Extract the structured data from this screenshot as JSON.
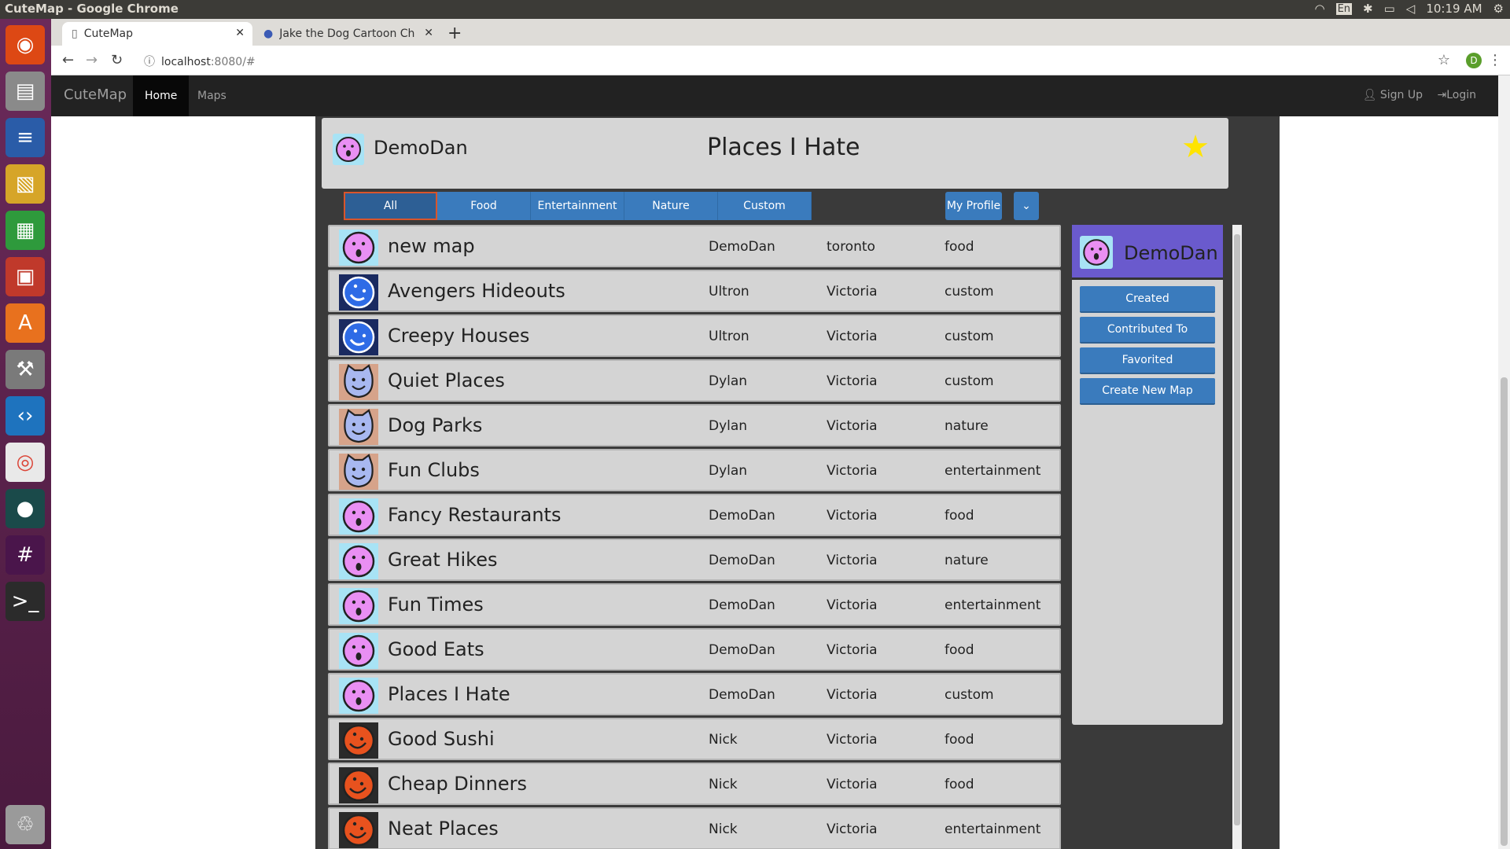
{
  "os": {
    "window_title": "CuteMap - Google Chrome",
    "clock": "10:19 AM",
    "kbd": "En"
  },
  "launcher": {
    "icons": [
      "ubuntu-icon",
      "files-icon",
      "writer-icon",
      "impress-draw-icon",
      "calc-icon",
      "presentation-icon",
      "software-center-icon",
      "settings-icon",
      "vscode-icon",
      "chrome-icon",
      "gitkraken-icon",
      "slack-icon",
      "terminal-icon",
      "trash-icon"
    ]
  },
  "browser": {
    "tabs": [
      {
        "label": "CuteMap"
      },
      {
        "label": "Jake the Dog Cartoon Ch"
      }
    ],
    "url_host": "localhost",
    "url_rest": ":8080/#",
    "profile_initial": "D"
  },
  "navbar": {
    "brand": "CuteMap",
    "home": "Home",
    "maps": "Maps",
    "signup": "Sign Up",
    "login": "Login"
  },
  "header": {
    "user": "DemoDan",
    "title": "Places I Hate"
  },
  "filters": [
    "All",
    "Food",
    "Entertainment",
    "Nature",
    "Custom"
  ],
  "side_buttons": {
    "profile": "My Profile"
  },
  "panel": {
    "name": "DemoDan",
    "buttons": [
      "Created",
      "Contributed To",
      "Favorited",
      "Create New Map"
    ]
  },
  "colors": {
    "pink": "#e98ff3",
    "pink_bg": "#a8e3f5",
    "blue_face": "#2e6be6",
    "blue_bg": "#1a2a60",
    "cat_bg": "#d6a38a",
    "cat_face": "#a8b8f0",
    "orange": "#e8521e",
    "orange_bg": "#2a2a2a"
  },
  "maps": [
    {
      "name": "new map",
      "owner": "DemoDan",
      "city": "toronto",
      "category": "food",
      "avatar": "pink"
    },
    {
      "name": "Avengers Hideouts",
      "owner": "Ultron",
      "city": "Victoria",
      "category": "custom",
      "avatar": "blue"
    },
    {
      "name": "Creepy Houses",
      "owner": "Ultron",
      "city": "Victoria",
      "category": "custom",
      "avatar": "blue"
    },
    {
      "name": "Quiet Places",
      "owner": "Dylan",
      "city": "Victoria",
      "category": "custom",
      "avatar": "cat"
    },
    {
      "name": "Dog Parks",
      "owner": "Dylan",
      "city": "Victoria",
      "category": "nature",
      "avatar": "cat"
    },
    {
      "name": "Fun Clubs",
      "owner": "Dylan",
      "city": "Victoria",
      "category": "entertainment",
      "avatar": "cat"
    },
    {
      "name": "Fancy Restaurants",
      "owner": "DemoDan",
      "city": "Victoria",
      "category": "food",
      "avatar": "pink"
    },
    {
      "name": "Great Hikes",
      "owner": "DemoDan",
      "city": "Victoria",
      "category": "nature",
      "avatar": "pink"
    },
    {
      "name": "Fun Times",
      "owner": "DemoDan",
      "city": "Victoria",
      "category": "entertainment",
      "avatar": "pink"
    },
    {
      "name": "Good Eats",
      "owner": "DemoDan",
      "city": "Victoria",
      "category": "food",
      "avatar": "pink"
    },
    {
      "name": "Places I Hate",
      "owner": "DemoDan",
      "city": "Victoria",
      "category": "custom",
      "avatar": "pink"
    },
    {
      "name": "Good Sushi",
      "owner": "Nick",
      "city": "Victoria",
      "category": "food",
      "avatar": "orange"
    },
    {
      "name": "Cheap Dinners",
      "owner": "Nick",
      "city": "Victoria",
      "category": "food",
      "avatar": "orange"
    },
    {
      "name": "Neat Places",
      "owner": "Nick",
      "city": "Victoria",
      "category": "entertainment",
      "avatar": "orange"
    }
  ]
}
